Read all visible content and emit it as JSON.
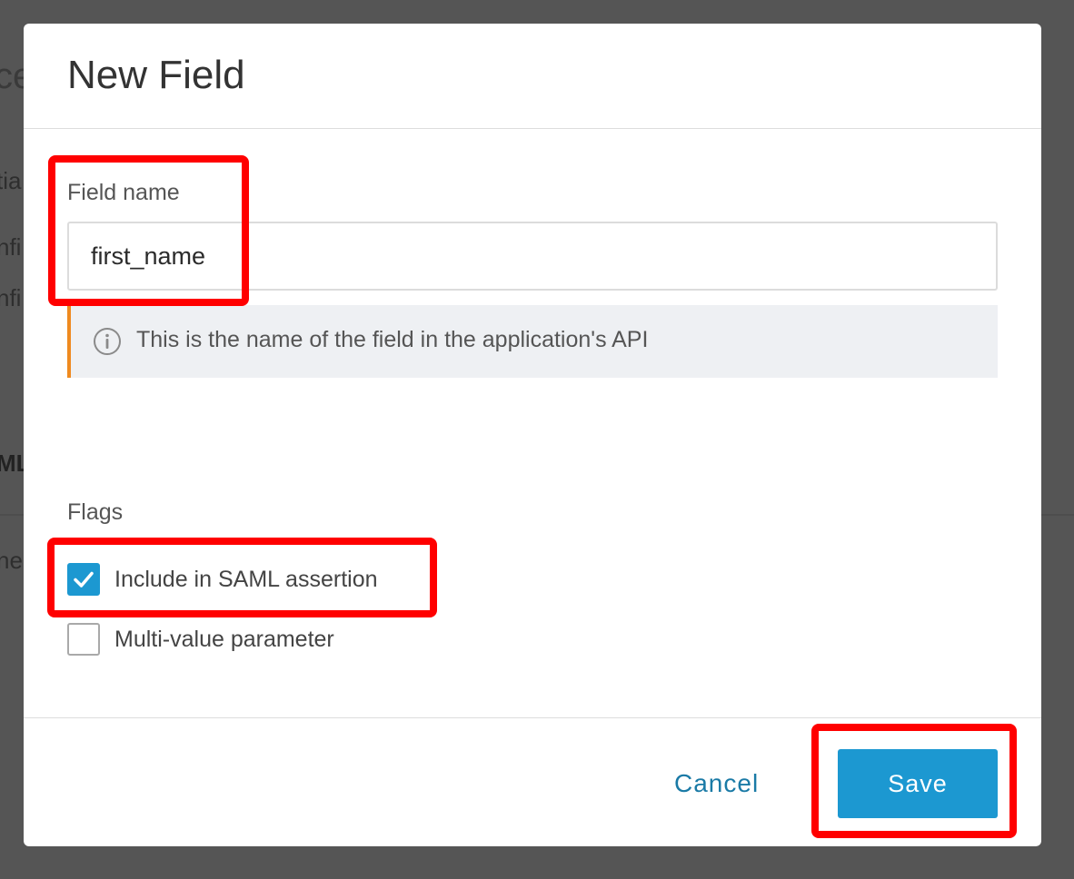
{
  "background": {
    "title_fragment": "ce",
    "line1": "tia",
    "line2": "nfi",
    "line3": "nfi",
    "line4": "ML",
    "line5": "ne"
  },
  "dialog": {
    "title": "New Field",
    "field_name_label": "Field name",
    "field_name_value": "first_name",
    "hint_icon": "info-circle-icon",
    "hint_text": "This is the name of the field in the application's API",
    "flags_label": "Flags",
    "flags": [
      {
        "label": "Include in SAML assertion",
        "checked": true
      },
      {
        "label": "Multi-value parameter",
        "checked": false
      }
    ],
    "cancel_label": "Cancel",
    "save_label": "Save"
  },
  "colors": {
    "accent": "#1c98d1",
    "link": "#1a7aa6",
    "hint_border": "#ef8a1f",
    "annotation_red": "#ff0000"
  }
}
